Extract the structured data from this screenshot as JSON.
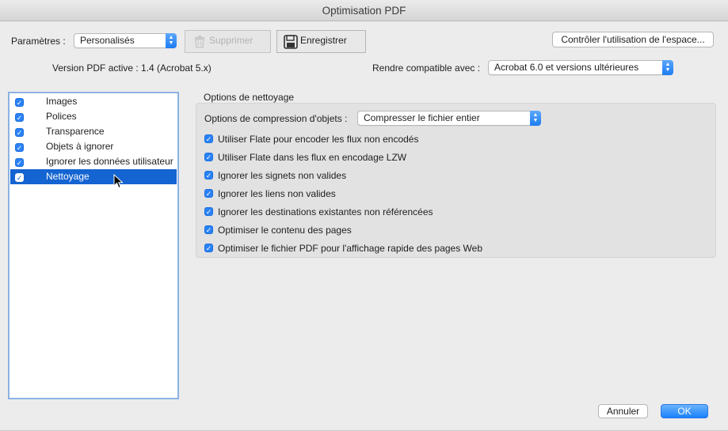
{
  "window": {
    "title": "Optimisation PDF"
  },
  "top": {
    "params_label": "Paramètres :",
    "params_value": "Personalisés",
    "delete_label": "Supprimer",
    "save_label": "Enregistrer",
    "audit_label": "Contrôler l'utilisation de l'espace..."
  },
  "version": {
    "active_label": "Version PDF active : 1.4 (Acrobat 5.x)",
    "compat_label": "Rendre compatible avec :",
    "compat_value": "Acrobat 6.0 et versions ultérieures"
  },
  "sidebar": {
    "items": [
      {
        "label": "Images",
        "checked": true
      },
      {
        "label": "Polices",
        "checked": true
      },
      {
        "label": "Transparence",
        "checked": true
      },
      {
        "label": "Objets à ignorer",
        "checked": true
      },
      {
        "label": "Ignorer les données utilisateur",
        "checked": true
      },
      {
        "label": "Nettoyage",
        "checked": true,
        "selected": true
      }
    ]
  },
  "panel": {
    "title": "Options de nettoyage",
    "compression_label": "Options de compression d'objets :",
    "compression_value": "Compresser le fichier entier",
    "options": [
      {
        "label": "Utiliser Flate pour encoder les flux non encodés",
        "checked": true
      },
      {
        "label": "Utiliser Flate dans les flux en encodage LZW",
        "checked": true
      },
      {
        "label": "Ignorer les signets non valides",
        "checked": true
      },
      {
        "label": "Ignorer les liens non valides",
        "checked": true
      },
      {
        "label": "Ignorer les destinations existantes non référencées",
        "checked": true
      },
      {
        "label": "Optimiser le contenu des pages",
        "checked": true
      },
      {
        "label": "Optimiser le fichier PDF pour l'affichage rapide des pages Web",
        "checked": true
      }
    ]
  },
  "footer": {
    "cancel_label": "Annuler",
    "ok_label": "OK"
  },
  "colors": {
    "accent": "#1a82fb",
    "selection": "#1464d2",
    "checkbox": "#2a82f5"
  }
}
